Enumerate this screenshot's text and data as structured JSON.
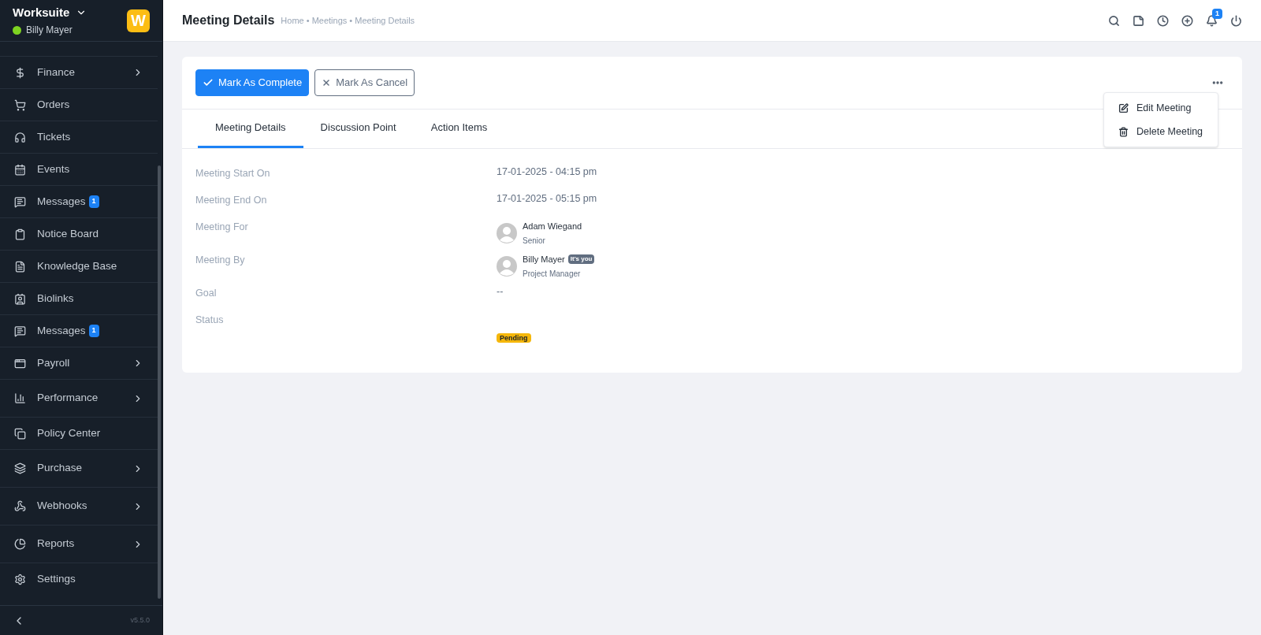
{
  "sidebar": {
    "app_name": "Worksuite",
    "user": {
      "name": "Billy Mayer",
      "online": true
    },
    "logo_letter": "W",
    "items": [
      {
        "label": "Finance",
        "submenu": true
      },
      {
        "label": "Orders",
        "submenu": false
      },
      {
        "label": "Tickets",
        "submenu": false
      },
      {
        "label": "Events",
        "submenu": false
      },
      {
        "label": "Messages",
        "submenu": false,
        "badge": "1"
      },
      {
        "label": "Notice Board",
        "submenu": false
      },
      {
        "label": "Knowledge Base",
        "submenu": false
      },
      {
        "label": "Biolinks",
        "submenu": false
      },
      {
        "label": "Messages",
        "submenu": false,
        "badge": "1"
      },
      {
        "label": "Payroll",
        "submenu": true
      },
      {
        "label": "Performance",
        "submenu": true
      },
      {
        "label": "Policy Center",
        "submenu": false
      },
      {
        "label": "Purchase",
        "submenu": true
      },
      {
        "label": "Webhooks",
        "submenu": true
      },
      {
        "label": "Reports",
        "submenu": true
      },
      {
        "label": "Settings",
        "submenu": false
      }
    ],
    "version": "v5.5.0"
  },
  "header": {
    "title": "Meeting Details",
    "breadcrumb": "Home • Meetings • Meeting Details",
    "notification_count": "1"
  },
  "actions": [
    {
      "label": "Mark As Complete",
      "kind": "primary"
    },
    {
      "label": "Mark As Cancel",
      "kind": "outline"
    }
  ],
  "more_menu": {
    "expanded": true,
    "items": [
      {
        "label": "Edit Meeting",
        "kind": "edit"
      },
      {
        "label": "Delete Meeting",
        "kind": "delete"
      }
    ]
  },
  "tabs": [
    {
      "label": "Meeting Details",
      "selected": true
    },
    {
      "label": "Discussion Point",
      "selected": false
    },
    {
      "label": "Action Items",
      "selected": false
    }
  ],
  "details": [
    {
      "label": "Meeting Start On",
      "kind": "text",
      "value": "17-01-2025 - 04:15 pm"
    },
    {
      "label": "Meeting End On",
      "kind": "text",
      "value": "17-01-2025 - 05:15 pm"
    },
    {
      "label": "Meeting For",
      "kind": "person",
      "name": "Adam Wiegand",
      "role": "Senior"
    },
    {
      "label": "Meeting By",
      "kind": "person",
      "name": "Billy Mayer",
      "role": "Project Manager",
      "tag": "It's you"
    },
    {
      "label": "Goal",
      "kind": "text",
      "value": "--"
    },
    {
      "label": "Status",
      "kind": "status",
      "value": "Pending",
      "color": "#f5b70b"
    }
  ]
}
